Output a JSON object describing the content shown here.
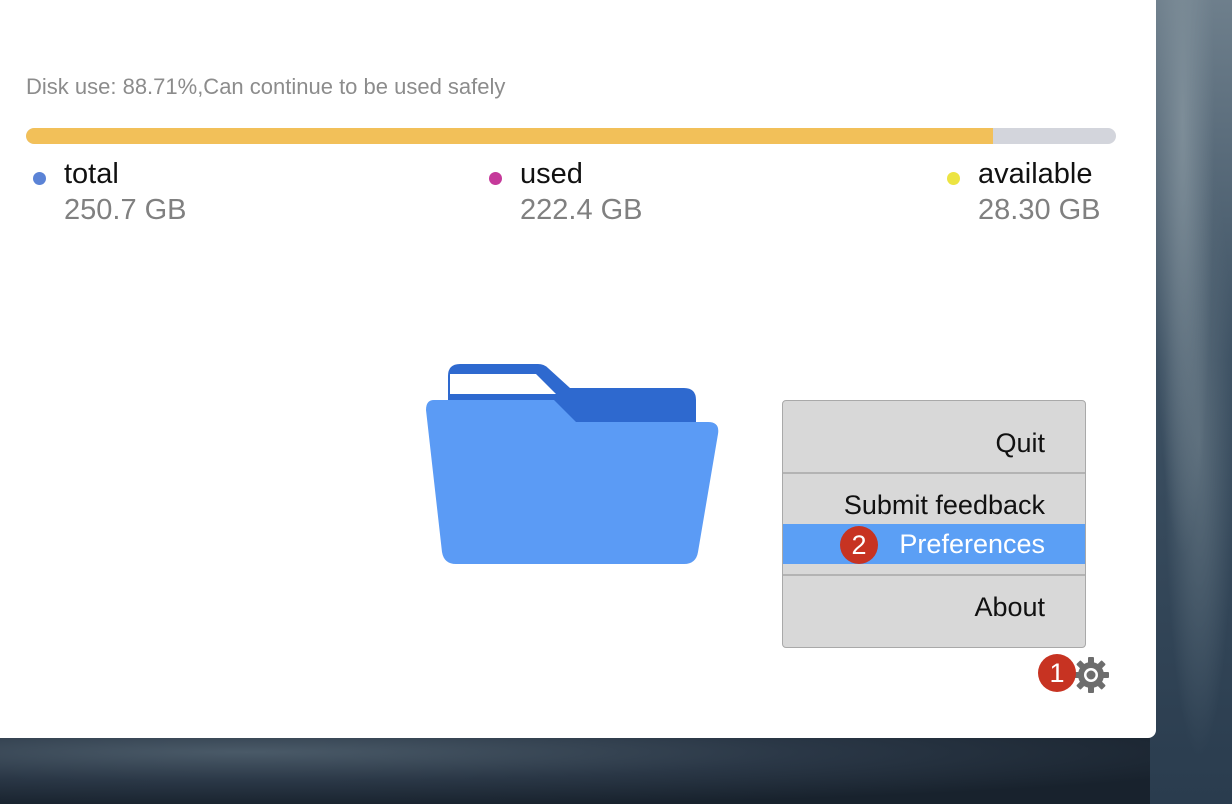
{
  "status": {
    "disk_use_text": "Disk use: 88.71%,Can continue to be used safely",
    "used_fraction": 0.8871
  },
  "stats": [
    {
      "label": "total",
      "value": "250.7 GB",
      "dot_color": "#5b83d6"
    },
    {
      "label": "used",
      "value": "222.4 GB",
      "dot_color": "#c5399a"
    },
    {
      "label": "available",
      "value": "28.30 GB",
      "dot_color": "#ece442"
    }
  ],
  "colors": {
    "bar_fill": "#f2c059",
    "bar_track": "#d3d5dc",
    "folder_front": "#5b9bf5",
    "folder_back": "#2e69cf",
    "menu_highlight": "#5b9ff5",
    "badge": "#c73322"
  },
  "menu": {
    "items": [
      "Quit",
      "Submit feedback",
      "Preferences",
      "About"
    ],
    "selected": "Preferences"
  },
  "annotations": {
    "step1": "1",
    "step2": "2"
  },
  "icons": {
    "folder": "folder-icon",
    "settings": "gear-icon"
  }
}
